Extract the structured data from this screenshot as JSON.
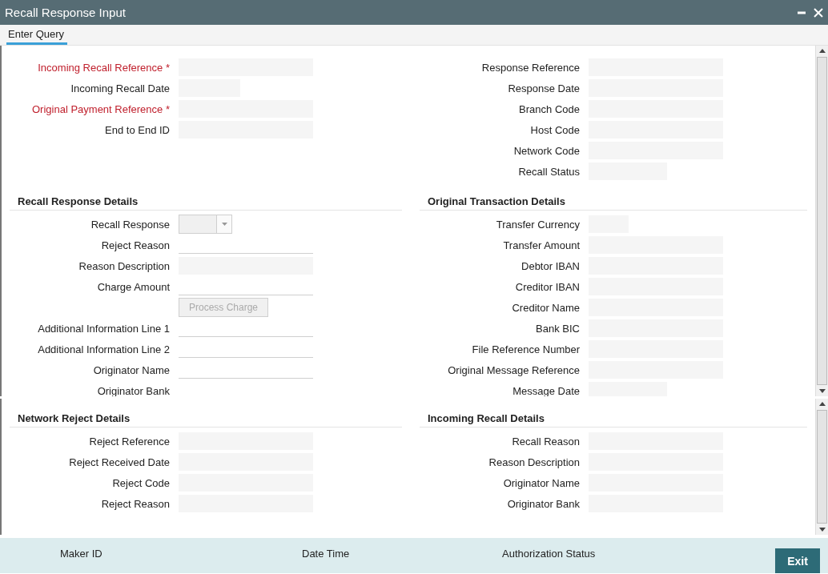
{
  "window": {
    "title": "Recall Response Input"
  },
  "toolbar": [
    {
      "label": "Enter Query",
      "selected": true
    }
  ],
  "main_panel": {
    "header_left": [
      {
        "label": "Incoming Recall Reference",
        "kind": "text",
        "required": true,
        "required_mark": "*"
      },
      {
        "label": "Incoming Recall Date",
        "kind": "date",
        "required": false
      },
      {
        "label": "Original Payment Reference",
        "kind": "text",
        "required": true,
        "required_mark": "*"
      },
      {
        "label": "End to End ID",
        "kind": "text",
        "required": false
      }
    ],
    "header_right": [
      {
        "label": "Response Reference",
        "kind": "text"
      },
      {
        "label": "Response Date",
        "kind": "text"
      },
      {
        "label": "Branch Code",
        "kind": "text"
      },
      {
        "label": "Host Code",
        "kind": "text"
      },
      {
        "label": "Network Code",
        "kind": "text"
      },
      {
        "label": "Recall Status",
        "kind": "date"
      }
    ],
    "left_section": {
      "title": "Recall Response Details",
      "fields": [
        {
          "label": "Recall Response",
          "kind": "select"
        },
        {
          "label": "Reject Reason",
          "kind": "line"
        },
        {
          "label": "Reason Description",
          "kind": "text"
        },
        {
          "label": "Charge Amount",
          "kind": "line"
        },
        {
          "label": "Process Charge",
          "kind": "button"
        },
        {
          "label": "Additional Information Line 1",
          "kind": "line"
        },
        {
          "label": "Additional Information Line 2",
          "kind": "line"
        },
        {
          "label": "Originator Name",
          "kind": "line"
        },
        {
          "label": "Originator Bank",
          "kind": "plain"
        }
      ]
    },
    "right_section": {
      "title": "Original Transaction Details",
      "fields": [
        {
          "label": "Transfer Currency",
          "kind": "code"
        },
        {
          "label": "Transfer Amount",
          "kind": "text"
        },
        {
          "label": "Debtor IBAN",
          "kind": "text"
        },
        {
          "label": "Creditor IBAN",
          "kind": "text"
        },
        {
          "label": "Creditor Name",
          "kind": "text"
        },
        {
          "label": "Bank BIC",
          "kind": "text"
        },
        {
          "label": "File Reference Number",
          "kind": "text"
        },
        {
          "label": "Original Message Reference",
          "kind": "text"
        },
        {
          "label": "Message Date",
          "kind": "date"
        }
      ]
    }
  },
  "lower_panel": {
    "left_section": {
      "title": "Network Reject Details",
      "fields": [
        {
          "label": "Reject Reference",
          "kind": "text"
        },
        {
          "label": "Reject Received Date",
          "kind": "text"
        },
        {
          "label": "Reject Code",
          "kind": "text"
        },
        {
          "label": "Reject Reason",
          "kind": "text"
        }
      ]
    },
    "right_section": {
      "title": "Incoming Recall Details",
      "fields": [
        {
          "label": "Recall Reason",
          "kind": "text"
        },
        {
          "label": "Reason Description",
          "kind": "text"
        },
        {
          "label": "Originator Name",
          "kind": "text"
        },
        {
          "label": "Originator Bank",
          "kind": "text"
        }
      ]
    }
  },
  "footer": {
    "labels": [
      "Maker ID",
      "Date Time",
      "Authorization Status"
    ],
    "exit_button": "Exit"
  }
}
